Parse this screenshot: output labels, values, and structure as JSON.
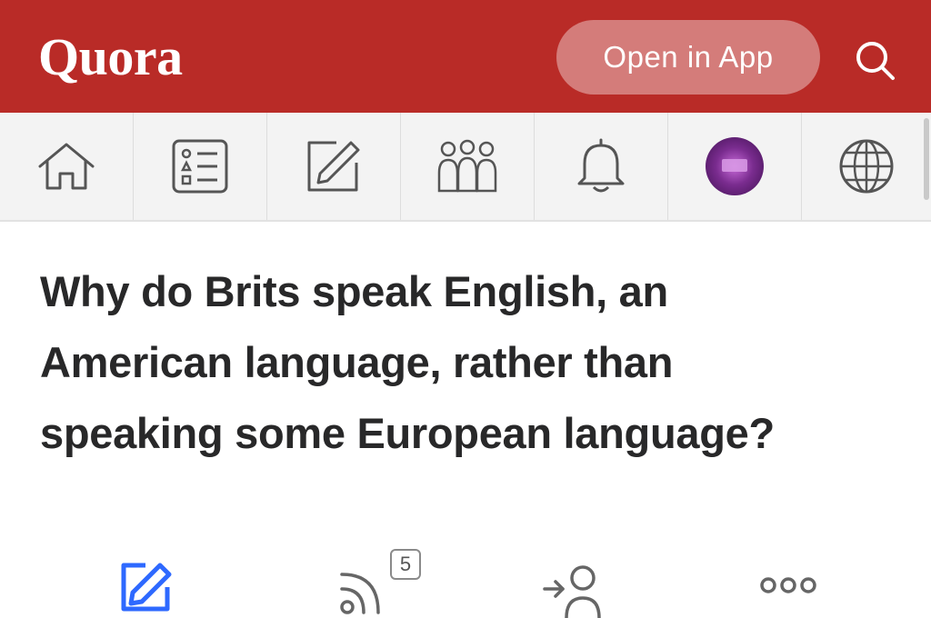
{
  "header": {
    "logo": "Quora",
    "open_in_app_label": "Open in App",
    "search_icon": "search-icon",
    "color": "#b92b27"
  },
  "nav": {
    "items": [
      {
        "name": "home",
        "icon": "home-icon"
      },
      {
        "name": "answer-list",
        "icon": "list-icon"
      },
      {
        "name": "write",
        "icon": "pencil-icon"
      },
      {
        "name": "spaces",
        "icon": "people-icon"
      },
      {
        "name": "notifications",
        "icon": "bell-icon"
      },
      {
        "name": "profile",
        "icon": "avatar"
      },
      {
        "name": "language",
        "icon": "globe-icon"
      }
    ]
  },
  "question": {
    "title": "Why do Brits speak English, an American language, rather than speaking some European language?"
  },
  "actions": {
    "answer_icon": "pencil-icon",
    "follow_icon": "rss-icon",
    "follow_count": "5",
    "request_icon": "add-person-icon",
    "more_icon": "more-icon",
    "accent_color": "#2e69ff"
  }
}
